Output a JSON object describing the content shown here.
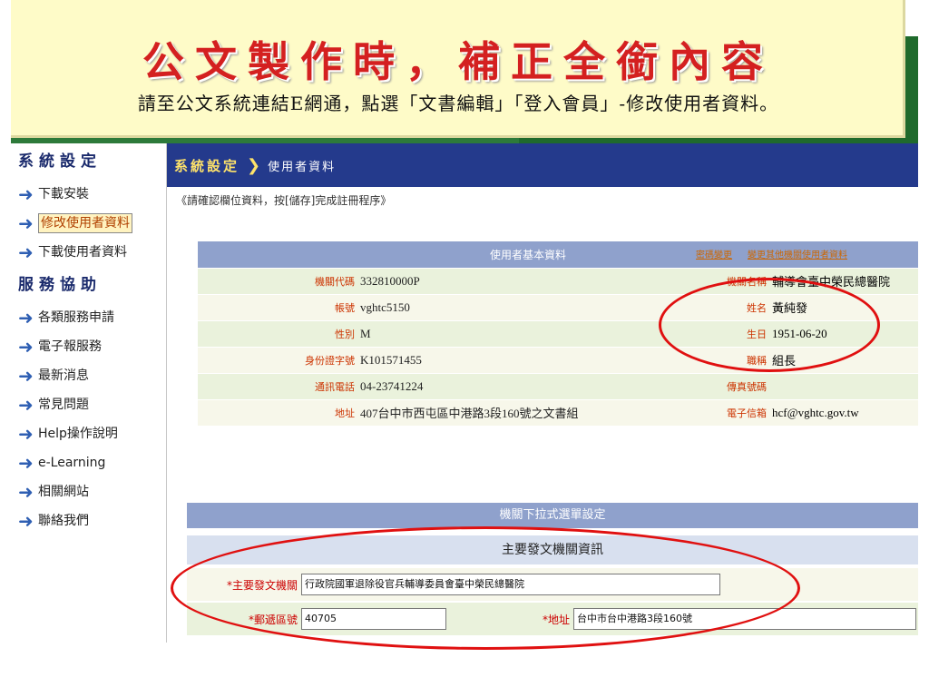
{
  "banner": {
    "title": "公文製作時，補正全銜內容",
    "subtitle": "請至公文系統連結E網通，點選「文書編輯」「登入會員」-修改使用者資料。"
  },
  "sidebar": {
    "section1": "系統設定",
    "items1": [
      "下載安裝",
      "修改使用者資料",
      "下載使用者資料"
    ],
    "section2": "服務協助",
    "items2": [
      "各類服務申請",
      "電子報服務",
      "最新消息",
      "常見問題",
      "Help操作說明",
      "e-Learning",
      "相關網站",
      "聯絡我們"
    ]
  },
  "breadcrumb": {
    "section": "系統設定",
    "separator": "❯",
    "page": "使用者資料"
  },
  "hint": "《請確認欄位資料，按[儲存]完成註冊程序》",
  "basic": {
    "header": "使用者基本資料",
    "link1": "密碼變更",
    "link2": "變更其他機關使用者資料",
    "rows": [
      {
        "l1": "機關代碼",
        "v1": "332810000P",
        "l2": "機關名稱",
        "v2": "輔導會臺中榮民總醫院"
      },
      {
        "l1": "帳號",
        "v1": "vghtc5150",
        "l2": "姓名",
        "v2": "黃純發"
      },
      {
        "l1": "性別",
        "v1": "M",
        "l2": "生日",
        "v2": "1951-06-20"
      },
      {
        "l1": "身份證字號",
        "v1": "K101571455",
        "l2": "職稱",
        "v2": "組長"
      },
      {
        "l1": "通訊電話",
        "v1": "04-23741224",
        "l2": "傳真號碼",
        "v2": ""
      },
      {
        "l1": "地址",
        "v1": "407台中市西屯區中港路3段160號之文書組",
        "l2": "電子信箱",
        "v2": "hcf@vghtc.gov.tw"
      }
    ]
  },
  "agency": {
    "section_title": "機關下拉式選單設定",
    "sub_title": "主要發文機關資訊",
    "main_agency_label": "*主要發文機關",
    "main_agency_value": "行政院國軍退除役官兵輔導委員會臺中榮民總醫院",
    "zip_label": "*郵遞區號",
    "zip_value": "40705",
    "address_label": "*地址",
    "address_value": "台中市台中港路3段160號"
  },
  "colors": {
    "annotation": "#e01010",
    "banner_bg": "#fefbc8",
    "title": "#d42020",
    "nav": "#243a8c"
  }
}
